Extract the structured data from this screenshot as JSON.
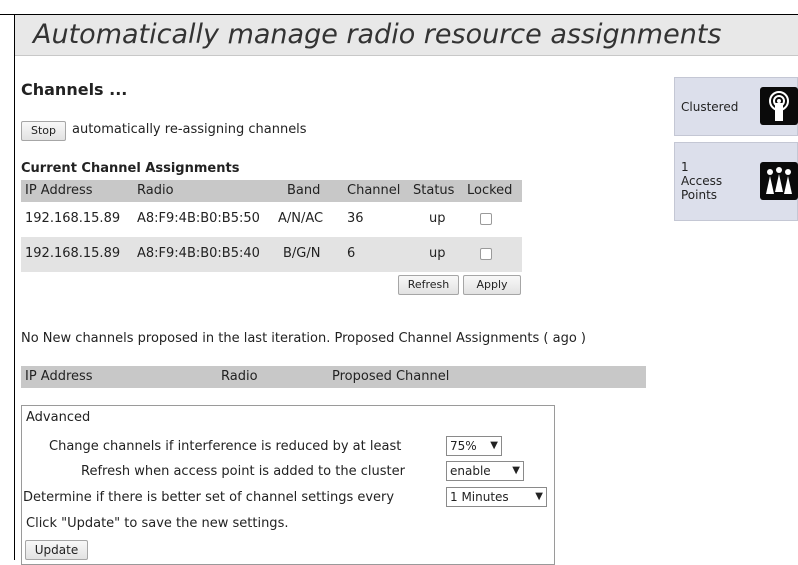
{
  "page_title": "Automatically manage radio resource assignments",
  "channels": {
    "heading": "Channels ...",
    "stop_button": "Stop",
    "status_text": "automatically re-assigning channels"
  },
  "current_assignments": {
    "title": "Current Channel Assignments",
    "columns": [
      "IP Address",
      "Radio",
      "Band",
      "Channel",
      "Status",
      "Locked"
    ],
    "rows": [
      {
        "ip": "192.168.15.89",
        "radio": "A8:F9:4B:B0:B5:50",
        "band": "A/N/AC",
        "channel": "36",
        "status": "up",
        "locked": false
      },
      {
        "ip": "192.168.15.89",
        "radio": "A8:F9:4B:B0:B5:40",
        "band": "B/G/N",
        "channel": "6",
        "status": "up",
        "locked": false
      }
    ],
    "refresh_button": "Refresh",
    "apply_button": "Apply"
  },
  "proposed": {
    "message": "No New channels proposed in the last iteration. Proposed Channel Assignments ( ago )",
    "columns": [
      "IP Address",
      "Radio",
      "Proposed Channel"
    ]
  },
  "advanced": {
    "title": "Advanced",
    "interference_label": "Change channels if interference is reduced by at least",
    "interference_value": "75%",
    "refresh_label": "Refresh when access point is added to the cluster",
    "refresh_value": "enable",
    "interval_label": "Determine if there is better set of channel settings every",
    "interval_value": "1 Minutes",
    "hint": "Click \"Update\" to save the new settings.",
    "update_button": "Update"
  },
  "sidebar": {
    "clustered_label": "Clustered",
    "ap_count_line1": "1",
    "ap_count_line2": "Access",
    "ap_count_line3": "Points"
  }
}
